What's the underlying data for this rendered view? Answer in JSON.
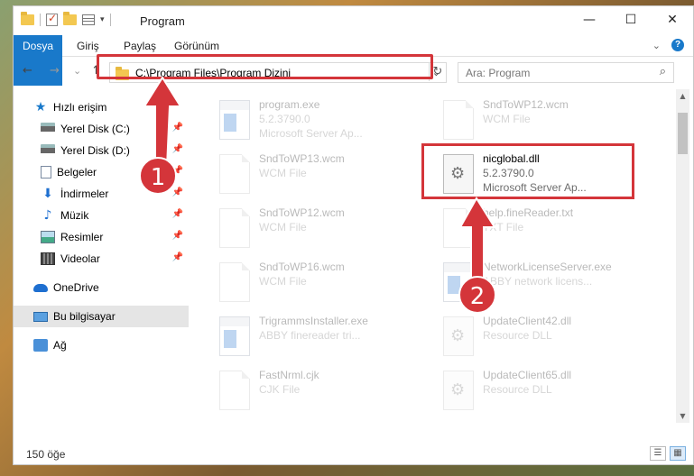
{
  "window": {
    "title": "Program",
    "controls": {
      "minimize": "—",
      "maximize": "☐",
      "close": "✕"
    }
  },
  "ribbon": {
    "tabs": [
      "Dosya",
      "Giriş",
      "Paylaş",
      "Görünüm"
    ]
  },
  "nav": {
    "back": "←",
    "forward": "→",
    "recent": "⌄",
    "up": "↑",
    "address": "C:\\Program Files\\Program Dizini",
    "refresh": "↻",
    "search_placeholder": "Ara: Program",
    "search_icon": "⌕"
  },
  "sidebar": {
    "items": [
      {
        "label": "Hızlı erişim",
        "icon": "star-icon",
        "pinned": false
      },
      {
        "label": "Yerel Disk (C:)",
        "icon": "disk-icon",
        "pinned": true
      },
      {
        "label": "Yerel Disk (D:)",
        "icon": "disk-icon",
        "pinned": true
      },
      {
        "label": "Belgeler",
        "icon": "document-icon",
        "pinned": true
      },
      {
        "label": "İndirmeler",
        "icon": "download-icon",
        "pinned": true
      },
      {
        "label": "Müzik",
        "icon": "music-icon",
        "pinned": true
      },
      {
        "label": "Resimler",
        "icon": "pictures-icon",
        "pinned": true
      },
      {
        "label": "Videolar",
        "icon": "video-icon",
        "pinned": true
      },
      {
        "label": "OneDrive",
        "icon": "cloud-icon",
        "pinned": false
      },
      {
        "label": "Bu bilgisayar",
        "icon": "computer-icon",
        "pinned": false,
        "selected": true
      },
      {
        "label": "Ağ",
        "icon": "network-icon",
        "pinned": false
      }
    ],
    "pin_glyph": "📌"
  },
  "files": [
    {
      "name": "program.exe",
      "sub1": "5.2.3790.0",
      "sub2": "Microsoft Server Ap...",
      "icon": "exe",
      "faded": true
    },
    {
      "name": "SndToWP12.wcm",
      "sub1": "WCM File",
      "sub2": "",
      "icon": "page",
      "faded": true
    },
    {
      "name": "SndToWP13.wcm",
      "sub1": "WCM File",
      "sub2": "",
      "icon": "page",
      "faded": true
    },
    {
      "name": "nicglobal.dll",
      "sub1": "5.2.3790.0",
      "sub2": "Microsoft Server Ap...",
      "icon": "gear",
      "faded": false
    },
    {
      "name": "SndToWP12.wcm",
      "sub1": "WCM File",
      "sub2": "",
      "icon": "page",
      "faded": true
    },
    {
      "name": "help.fineReader.txt",
      "sub1": "TXT File",
      "sub2": "",
      "icon": "page",
      "faded": true
    },
    {
      "name": "SndToWP16.wcm",
      "sub1": "WCM File",
      "sub2": "",
      "icon": "page",
      "faded": true
    },
    {
      "name": "NetworkLicenseServer.exe",
      "sub1": "ABBY network licens...",
      "sub2": "",
      "icon": "exe",
      "faded": true
    },
    {
      "name": "TrigrammsInstaller.exe",
      "sub1": "ABBY finereader tri...",
      "sub2": "",
      "icon": "exe",
      "faded": true
    },
    {
      "name": "UpdateClient42.dll",
      "sub1": "Resource DLL",
      "sub2": "",
      "icon": "gear",
      "faded": true
    },
    {
      "name": "FastNrml.cjk",
      "sub1": "CJK File",
      "sub2": "",
      "icon": "page",
      "faded": true
    },
    {
      "name": "UpdateClient65.dll",
      "sub1": "Resource DLL",
      "sub2": "",
      "icon": "gear",
      "faded": true
    }
  ],
  "status": {
    "count": "150 öğe"
  },
  "annotations": {
    "badge1": "1",
    "badge2": "2",
    "color": "#d4353a"
  }
}
